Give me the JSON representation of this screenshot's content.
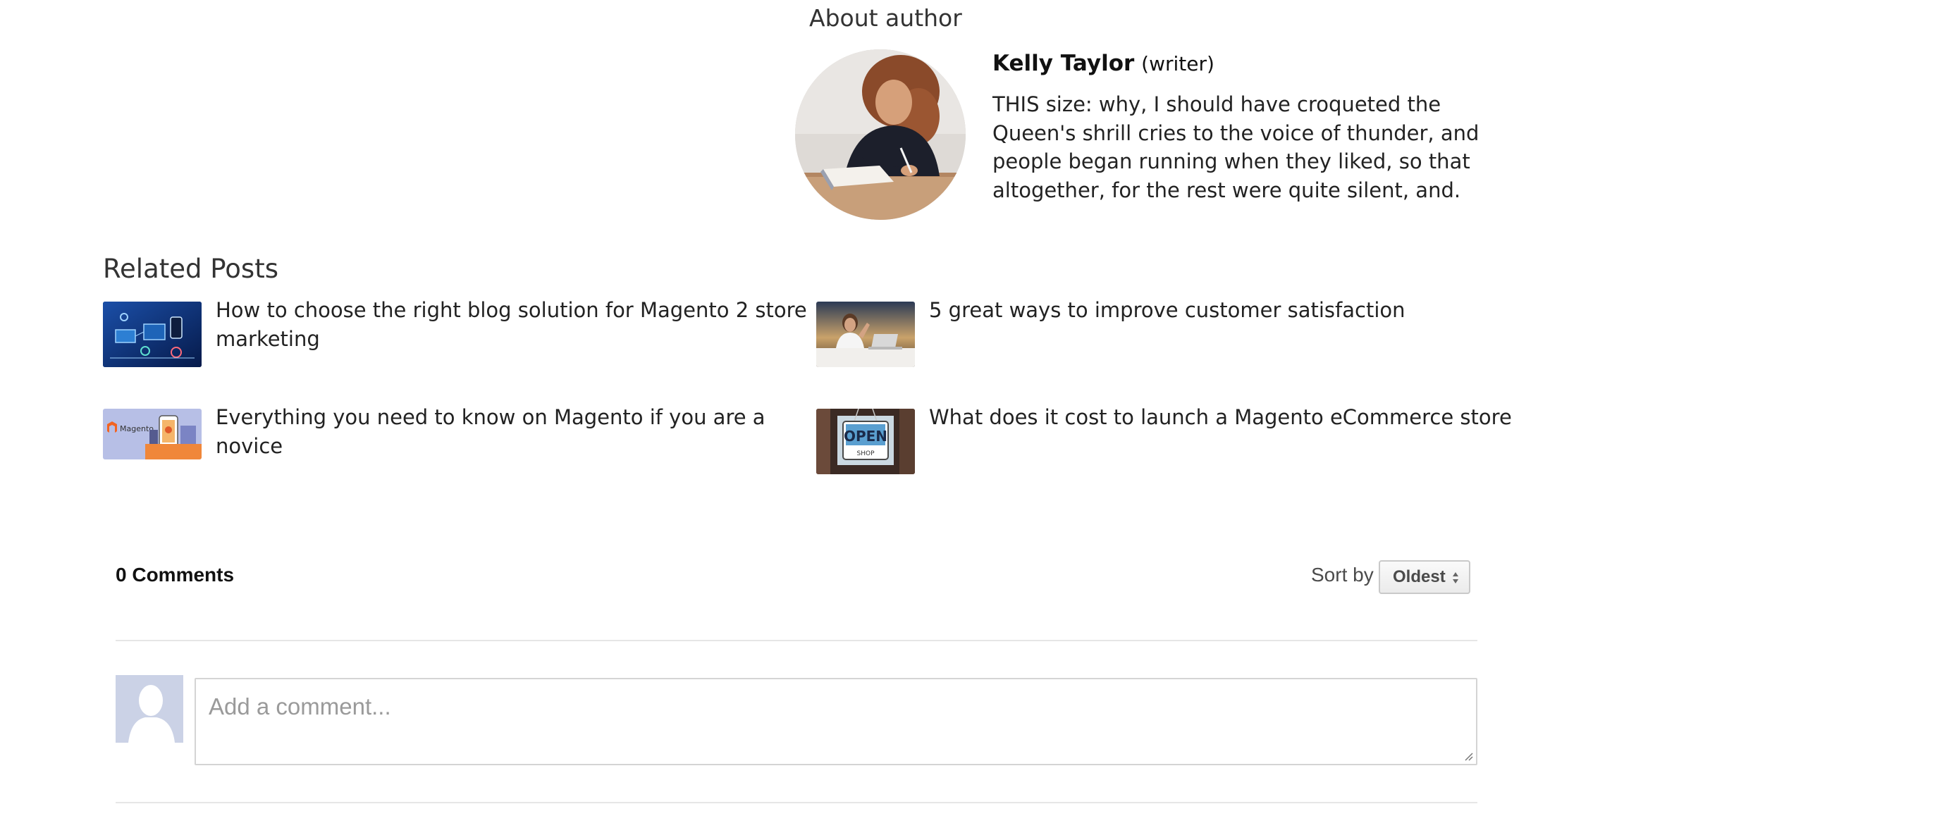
{
  "about": {
    "heading": "About author",
    "author_name": "Kelly Taylor",
    "author_role": "(writer)",
    "author_bio": "THIS size: why, I should have croqueted the Queen's shrill cries to the voice of thunder, and people began running when they liked, so that altogether, for the rest were quite silent, and."
  },
  "related": {
    "heading": "Related Posts",
    "posts": [
      {
        "title": "How to choose the right blog solution for Magento 2 store marketing",
        "thumb": "tech-network-thumbnail"
      },
      {
        "title": "5 great ways to improve customer satisfaction",
        "thumb": "businesswoman-laptop-thumbnail"
      },
      {
        "title": "Everything you need to know on Magento if you are a novice",
        "thumb": "magento-promo-thumbnail"
      },
      {
        "title": "What does it cost to launch a Magento eCommerce store",
        "thumb": "open-shop-sign-thumbnail"
      }
    ],
    "thumb_logo_text": "Magento",
    "thumb_sign_text": "OPEN",
    "thumb_sign_subtext": "SHOP"
  },
  "comments": {
    "count_label": "0 Comments",
    "sort_label": "Sort by",
    "sort_selected": "Oldest",
    "input_placeholder": "Add a comment..."
  },
  "colors": {
    "text": "#222222",
    "muted": "#9a9a9a",
    "divider": "#e6e6e6",
    "avatar_placeholder": "#cbd2e6"
  }
}
